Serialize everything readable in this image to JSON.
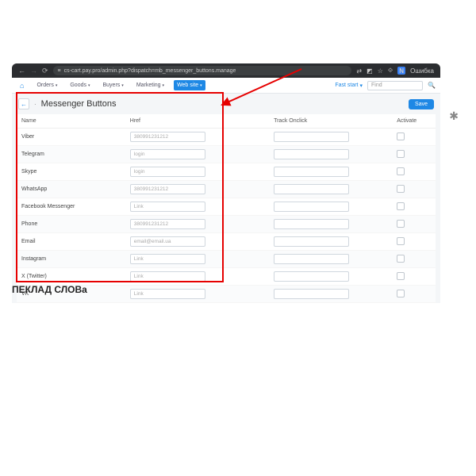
{
  "browser": {
    "url": "cs-cart.pay.pro/admin.php?dispatch=mb_messenger_buttons.manage",
    "user_initial": "N",
    "error_label": "Ошибка"
  },
  "nav": {
    "items": [
      "Orders",
      "Goods",
      "Buyers",
      "Marketing",
      "Web site"
    ],
    "fast_start": "Fast start",
    "search_placeholder": "Find"
  },
  "page": {
    "title": "Messenger Buttons",
    "save": "Save"
  },
  "table": {
    "headers": {
      "name": "Name",
      "href": "Href",
      "track": "Track Onclick",
      "activate": "Activate"
    },
    "rows": [
      {
        "name": "Viber",
        "href": "380991231212"
      },
      {
        "name": "Telegram",
        "href": "login"
      },
      {
        "name": "Skype",
        "href": "login"
      },
      {
        "name": "WhatsApp",
        "href": "380991231212"
      },
      {
        "name": "Facebook Messenger",
        "href": "Link"
      },
      {
        "name": "Phone",
        "href": "380991231212"
      },
      {
        "name": "Email",
        "href": "email@email.ua"
      },
      {
        "name": "Instagram",
        "href": "Link"
      },
      {
        "name": "X (Twitter)",
        "href": "Link"
      },
      {
        "name": "VK",
        "href": "Link"
      }
    ]
  },
  "cropped_text": "ПЕКЛАД СЛОВа"
}
